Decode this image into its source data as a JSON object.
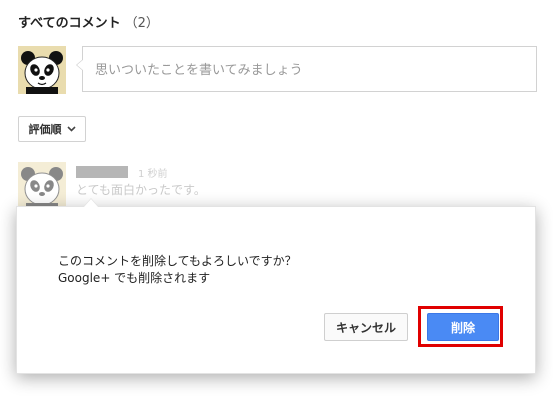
{
  "comments_header": {
    "title": "すべてのコメント",
    "count": "（2）"
  },
  "composer": {
    "placeholder": "思いついたことを書いてみましょう"
  },
  "sort": {
    "label": "評価順"
  },
  "comment": {
    "time": "1 秒前",
    "text": "とても面白かったです。"
  },
  "dialog": {
    "message_line1": "このコメントを削除してもよろしいですか？",
    "message_line2": "Google+ でも削除されます",
    "cancel_label": "キャンセル",
    "delete_label": "削除"
  },
  "colors": {
    "delete_button": "#4a8af4",
    "highlight_box": "#e00000",
    "avatar_background": "#e9dcae"
  },
  "icons": {
    "avatar": "panda-icon",
    "sort_toggle": "chevron-down-icon"
  }
}
